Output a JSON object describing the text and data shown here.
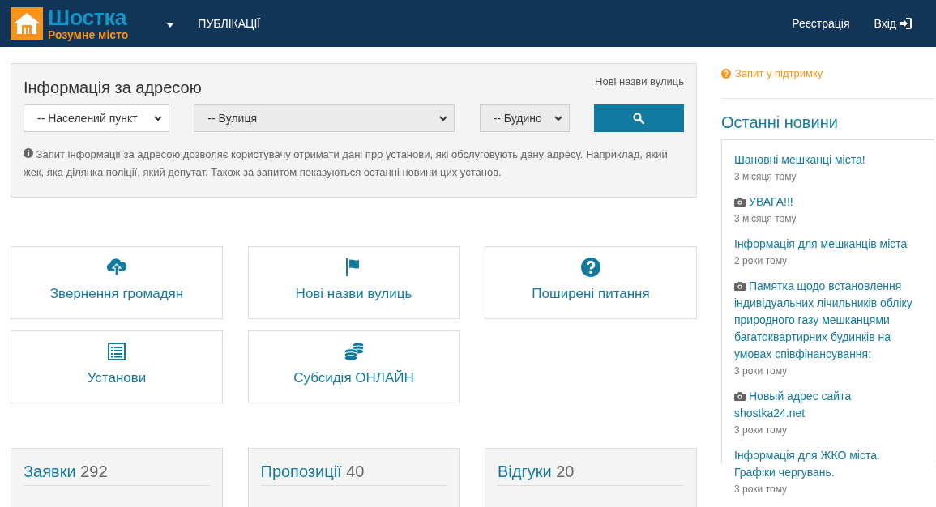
{
  "navbar": {
    "logo": {
      "title": "Шостка",
      "subtitle": "Розумне місто"
    },
    "menu": [
      {
        "label": "ПУБЛІКАЦІЇ"
      }
    ],
    "auth": [
      {
        "label": "Реєстрація",
        "kind": "text"
      },
      {
        "label": "Вхід",
        "kind": "signin"
      }
    ]
  },
  "address_panel": {
    "title": "Інформація за адресою",
    "link": "Нові назви вулиць",
    "fields": [
      {
        "placeholder": "-- Населений пункт",
        "disabled": false
      },
      {
        "placeholder": "-- Вулиця",
        "disabled": true
      },
      {
        "placeholder": "-- Будино",
        "disabled": true
      }
    ],
    "note": "Запит інформації за адресою дозволяє користувачу отримати дані про установи, які обслуговують дану адресу. Наприклад, який жек, яка ділянка поліції, який депутат. Також за запитом показуються останні новини цих установ."
  },
  "tiles": [
    {
      "label": "Звернення громадян",
      "kind": "upload"
    },
    {
      "label": "Нові назви вулиць",
      "kind": "flag"
    },
    {
      "label": "Поширені питання",
      "kind": "question"
    },
    {
      "label": "Установи",
      "kind": "list"
    },
    {
      "label": "Субсидія ОНЛАЙН",
      "kind": "coins"
    }
  ],
  "stats": [
    {
      "label": "Заявки",
      "count": "292"
    },
    {
      "label": "Пропозиції",
      "count": "40"
    },
    {
      "label": "Відгуки",
      "count": "20"
    }
  ],
  "sidebar": {
    "support_link": "Запит у підтримку",
    "news_title": "Останні новини",
    "news": [
      {
        "title": "Шановні мешканці міста!",
        "time": "3 місяця тому",
        "photo": false
      },
      {
        "title": "УВАГА!!!",
        "time": "3 місяця тому",
        "photo": true
      },
      {
        "title": "Інформація для мешканців міста",
        "time": "2 роки тому",
        "photo": false
      },
      {
        "title": "Памятка щодо встановлення індивідуальних лічильників обліку природного газу мешканцями багатоквартирних будинків на умовах співфінансування:",
        "time": "3 роки тому",
        "photo": true
      },
      {
        "title": "Новый адрес сайта shostka24.net",
        "time": "3 роки тому",
        "photo": true
      },
      {
        "title": "Інформація для ЖКО міста. Графіки чергувань.",
        "time": "3 роки тому",
        "photo": false
      }
    ]
  }
}
